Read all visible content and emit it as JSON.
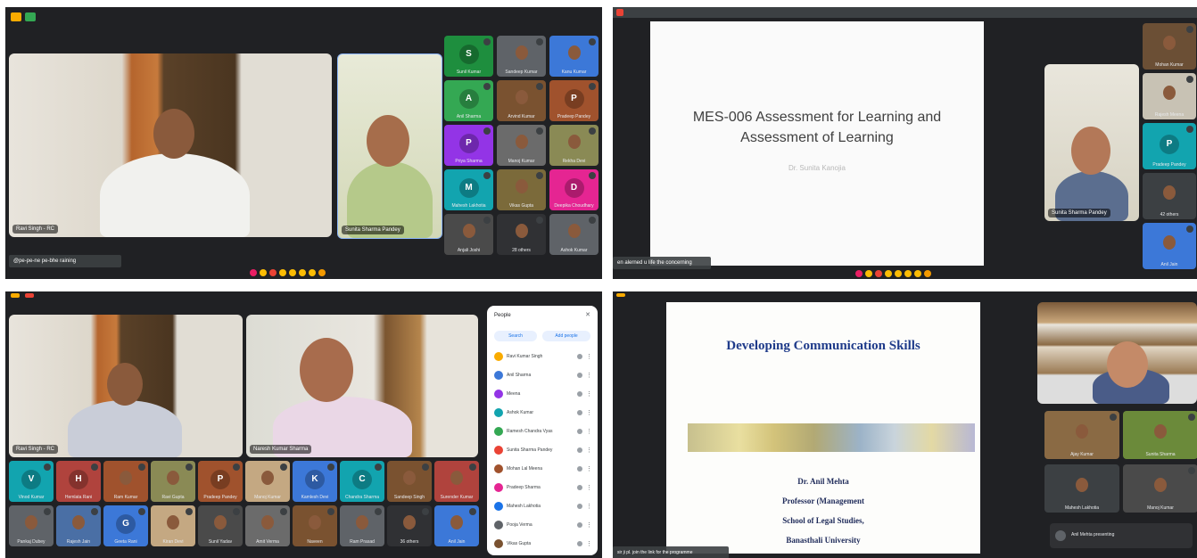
{
  "q1": {
    "main_name": "Ravi Singh - RC",
    "second_name": "Sunita Sharma Pandey",
    "subtitle": "@pe-pe-ne pe-bhe raining",
    "grid": [
      {
        "label": "S",
        "name": "Sunil Kumar",
        "color": "#1e8e3e"
      },
      {
        "label": "",
        "name": "Sandeep Kumar",
        "color": "#5f6368"
      },
      {
        "label": "",
        "name": "Kanu Kumar",
        "color": "#3c78d8"
      },
      {
        "label": "A",
        "name": "Anil Sharma",
        "color": "#34a853"
      },
      {
        "label": "",
        "name": "Arvind Kumar",
        "color": "#7a5230"
      },
      {
        "label": "P",
        "name": "Pradeep Pandey",
        "color": "#a0522d"
      },
      {
        "label": "P",
        "name": "Priya Sharma",
        "color": "#9334e6"
      },
      {
        "label": "",
        "name": "Manoj Kumar",
        "color": "#6b6b6b"
      },
      {
        "label": "",
        "name": "Rekha Devi",
        "color": "#8a8a55"
      },
      {
        "label": "M",
        "name": "Mahesh Lakhotia",
        "color": "#12a4af"
      },
      {
        "label": "",
        "name": "Vikas Gupta",
        "color": "#7b6a3a"
      },
      {
        "label": "D",
        "name": "Deepika Choudhary",
        "color": "#e52592"
      },
      {
        "label": "",
        "name": "Anjali Joshi",
        "color": "#4a4a4a"
      },
      {
        "label": "",
        "name": "28 others",
        "color": "#303134"
      },
      {
        "label": "",
        "name": "Ashok Kumar",
        "color": "#5f6368"
      }
    ]
  },
  "q2": {
    "slide_title": "MES-006 Assessment for Learning and Assessment of Learning",
    "slide_sub": "Dr. Sunita Kanojia",
    "cam_name": "Sunita Sharma Pandey",
    "subtitle": "en alerned u life the concerning",
    "side": [
      {
        "label": "",
        "name": "Mohan Kumar"
      },
      {
        "label": "",
        "name": "Rajesh Meena"
      },
      {
        "label": "P",
        "name": "Pradeep Pandey"
      },
      {
        "label": "",
        "name": "42 others"
      },
      {
        "label": "",
        "name": "Anil Jain"
      }
    ]
  },
  "q3": {
    "main_name": "Ravi Singh - RC",
    "second_name": "Naresh Kumar Sharma",
    "panel_title": "People",
    "add_people": "Add people",
    "search": "Search",
    "people": [
      "Ravi Kumar Singh",
      "Anil Sharma",
      "Meena",
      "Ashok Kumar",
      "Ramesh Chandra Vyas",
      "Sunita Sharma Pandey",
      "Mohan Lal Meena",
      "Pradeep Sharma",
      "Mahesh Lakhotia",
      "Pooja Verma",
      "Vikas Gupta"
    ],
    "strip1": [
      {
        "label": "V",
        "name": "Vinod Kumar",
        "color": "#12a4af"
      },
      {
        "label": "H",
        "name": "Hemlata Rani",
        "color": "#b0433d"
      },
      {
        "label": "",
        "name": "Ram Kumar",
        "color": "#a0522d"
      },
      {
        "label": "",
        "name": "Ravi Gupta",
        "color": "#8a8a55"
      },
      {
        "label": "P",
        "name": "Pradeep Pandey",
        "color": "#a0522d"
      },
      {
        "label": "",
        "name": "Manoj Kumar",
        "color": "#c4a882"
      },
      {
        "label": "K",
        "name": "Kamlesh Devi",
        "color": "#3c78d8"
      },
      {
        "label": "C",
        "name": "Chandra Sharma",
        "color": "#12a4af"
      },
      {
        "label": "",
        "name": "Sandeep Singh",
        "color": "#7a5230"
      },
      {
        "label": "",
        "name": "Surender Kumar",
        "color": "#b0433d"
      }
    ],
    "strip2": [
      {
        "label": "",
        "name": "Pankaj Dubey",
        "color": "#5f6368"
      },
      {
        "label": "",
        "name": "Rajesh Jain",
        "color": "#4a6fa5"
      },
      {
        "label": "G",
        "name": "Geeta Rani",
        "color": "#3c78d8"
      },
      {
        "label": "",
        "name": "Kiran Devi",
        "color": "#c4a882"
      },
      {
        "label": "",
        "name": "Sunil Yadav",
        "color": "#4a4a4a"
      },
      {
        "label": "",
        "name": "Amit Verma",
        "color": "#6b6b6b"
      },
      {
        "label": "",
        "name": "Naveen",
        "color": "#7a5230"
      },
      {
        "label": "",
        "name": "Ram Prasad",
        "color": "#5f6368"
      },
      {
        "label": "",
        "name": "36 others",
        "color": "#303134"
      },
      {
        "label": "",
        "name": "Anil Jain",
        "color": "#3c78d8"
      }
    ]
  },
  "q4": {
    "slide_title": "Developing Communication Skills",
    "presenter": "Dr. Anil Mehta",
    "role": "Professor (Management",
    "school": "School of Legal Studies,",
    "university": "Banasthali University",
    "subtitle": "sir ji pl. join the link for the programme",
    "presenting": "Anil Mehta presenting",
    "grid": [
      {
        "label": "",
        "name": "Ajay Kumar"
      },
      {
        "label": "",
        "name": "Sunita Sharma"
      },
      {
        "label": "",
        "name": "Mahesh Lakhotia"
      },
      {
        "label": "",
        "name": "Manoj Kumar"
      }
    ]
  }
}
